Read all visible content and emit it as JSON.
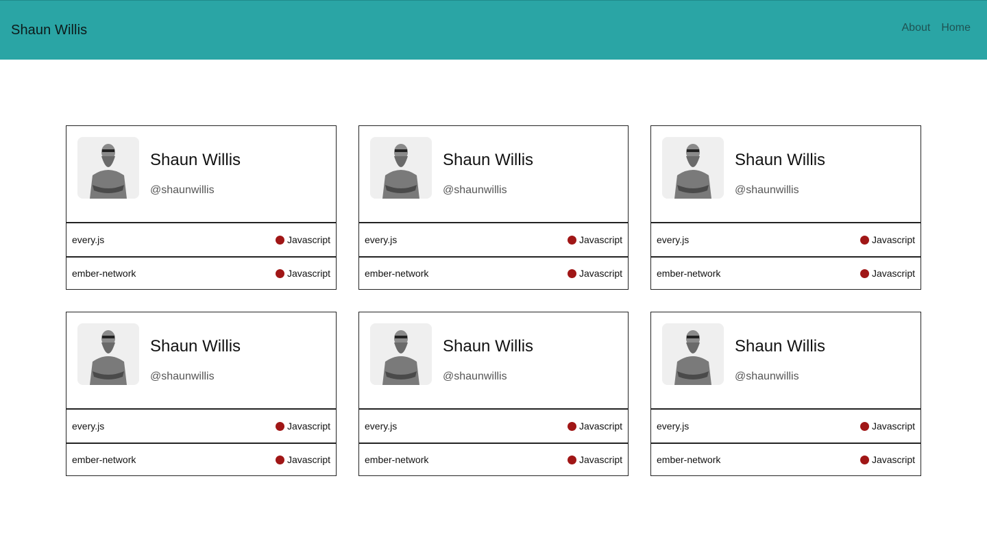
{
  "header": {
    "brand": "Shaun Willis",
    "nav": [
      {
        "label": "About"
      },
      {
        "label": "Home"
      }
    ]
  },
  "colors": {
    "header_bg": "#2aa5a5",
    "language_dot": "#a01616"
  },
  "cards": [
    {
      "name": "Shaun Willis",
      "handle": "@shaunwillis",
      "repos": [
        {
          "name": "every.js",
          "language": "Javascript"
        },
        {
          "name": "ember-network",
          "language": "Javascript"
        }
      ]
    },
    {
      "name": "Shaun Willis",
      "handle": "@shaunwillis",
      "repos": [
        {
          "name": "every.js",
          "language": "Javascript"
        },
        {
          "name": "ember-network",
          "language": "Javascript"
        }
      ]
    },
    {
      "name": "Shaun Willis",
      "handle": "@shaunwillis",
      "repos": [
        {
          "name": "every.js",
          "language": "Javascript"
        },
        {
          "name": "ember-network",
          "language": "Javascript"
        }
      ]
    },
    {
      "name": "Shaun Willis",
      "handle": "@shaunwillis",
      "repos": [
        {
          "name": "every.js",
          "language": "Javascript"
        },
        {
          "name": "ember-network",
          "language": "Javascript"
        }
      ]
    },
    {
      "name": "Shaun Willis",
      "handle": "@shaunwillis",
      "repos": [
        {
          "name": "every.js",
          "language": "Javascript"
        },
        {
          "name": "ember-network",
          "language": "Javascript"
        }
      ]
    },
    {
      "name": "Shaun Willis",
      "handle": "@shaunwillis",
      "repos": [
        {
          "name": "every.js",
          "language": "Javascript"
        },
        {
          "name": "ember-network",
          "language": "Javascript"
        }
      ]
    }
  ]
}
